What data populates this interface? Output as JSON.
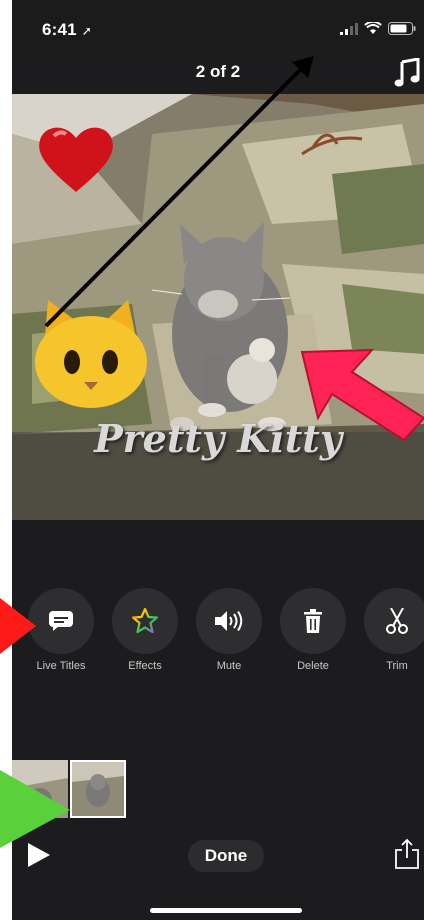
{
  "status_bar": {
    "time": "6:41"
  },
  "nav": {
    "title": "2 of 2",
    "music_icon": "music-note-icon"
  },
  "preview": {
    "title_text": "Pretty Kitty",
    "stickers": [
      "heart",
      "cat-face"
    ]
  },
  "toolbar": {
    "items": [
      {
        "label": "Live Titles",
        "icon": "speech-bubble-icon"
      },
      {
        "label": "Effects",
        "icon": "star-icon"
      },
      {
        "label": "Mute",
        "icon": "speaker-icon"
      },
      {
        "label": "Delete",
        "icon": "trash-icon"
      },
      {
        "label": "Trim",
        "icon": "scissors-icon"
      }
    ]
  },
  "timeline": {
    "clip_count": 2,
    "selected_clip": 2
  },
  "bottom_bar": {
    "done_label": "Done",
    "play_icon": "play-icon",
    "share_icon": "share-icon"
  },
  "colors": {
    "background": "#1c1c1e",
    "button": "#2e2e30",
    "annotation_red": "#ff1744",
    "annotation_pink": "#ff2455",
    "annotation_green": "#5ad13a"
  }
}
